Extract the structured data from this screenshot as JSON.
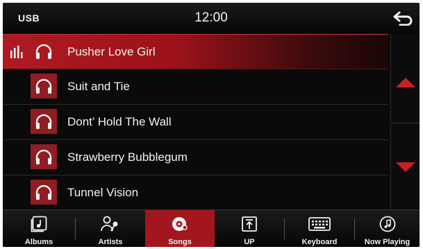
{
  "status": {
    "source": "USB",
    "time": "12:00"
  },
  "songs": [
    {
      "title": "Pusher Love Girl",
      "playing": true
    },
    {
      "title": "Suit and Tie",
      "playing": false
    },
    {
      "title": "Dont’ Hold The Wall",
      "playing": false
    },
    {
      "title": "Strawberry Bubblegum",
      "playing": false
    },
    {
      "title": "Tunnel Vision",
      "playing": false
    }
  ],
  "tabs": [
    {
      "label": "Albums",
      "icon": "album-icon"
    },
    {
      "label": "Artists",
      "icon": "artist-icon"
    },
    {
      "label": "Songs",
      "icon": "disc-icon",
      "active": true
    },
    {
      "label": "UP",
      "icon": "up-folder-icon"
    },
    {
      "label": "Keyboard",
      "icon": "keyboard-icon"
    },
    {
      "label": "Now Playing",
      "icon": "music-note-icon"
    }
  ],
  "colors": {
    "accent": "#a3161d",
    "background": "#0a0a0a",
    "text": "#f2f2f2"
  }
}
